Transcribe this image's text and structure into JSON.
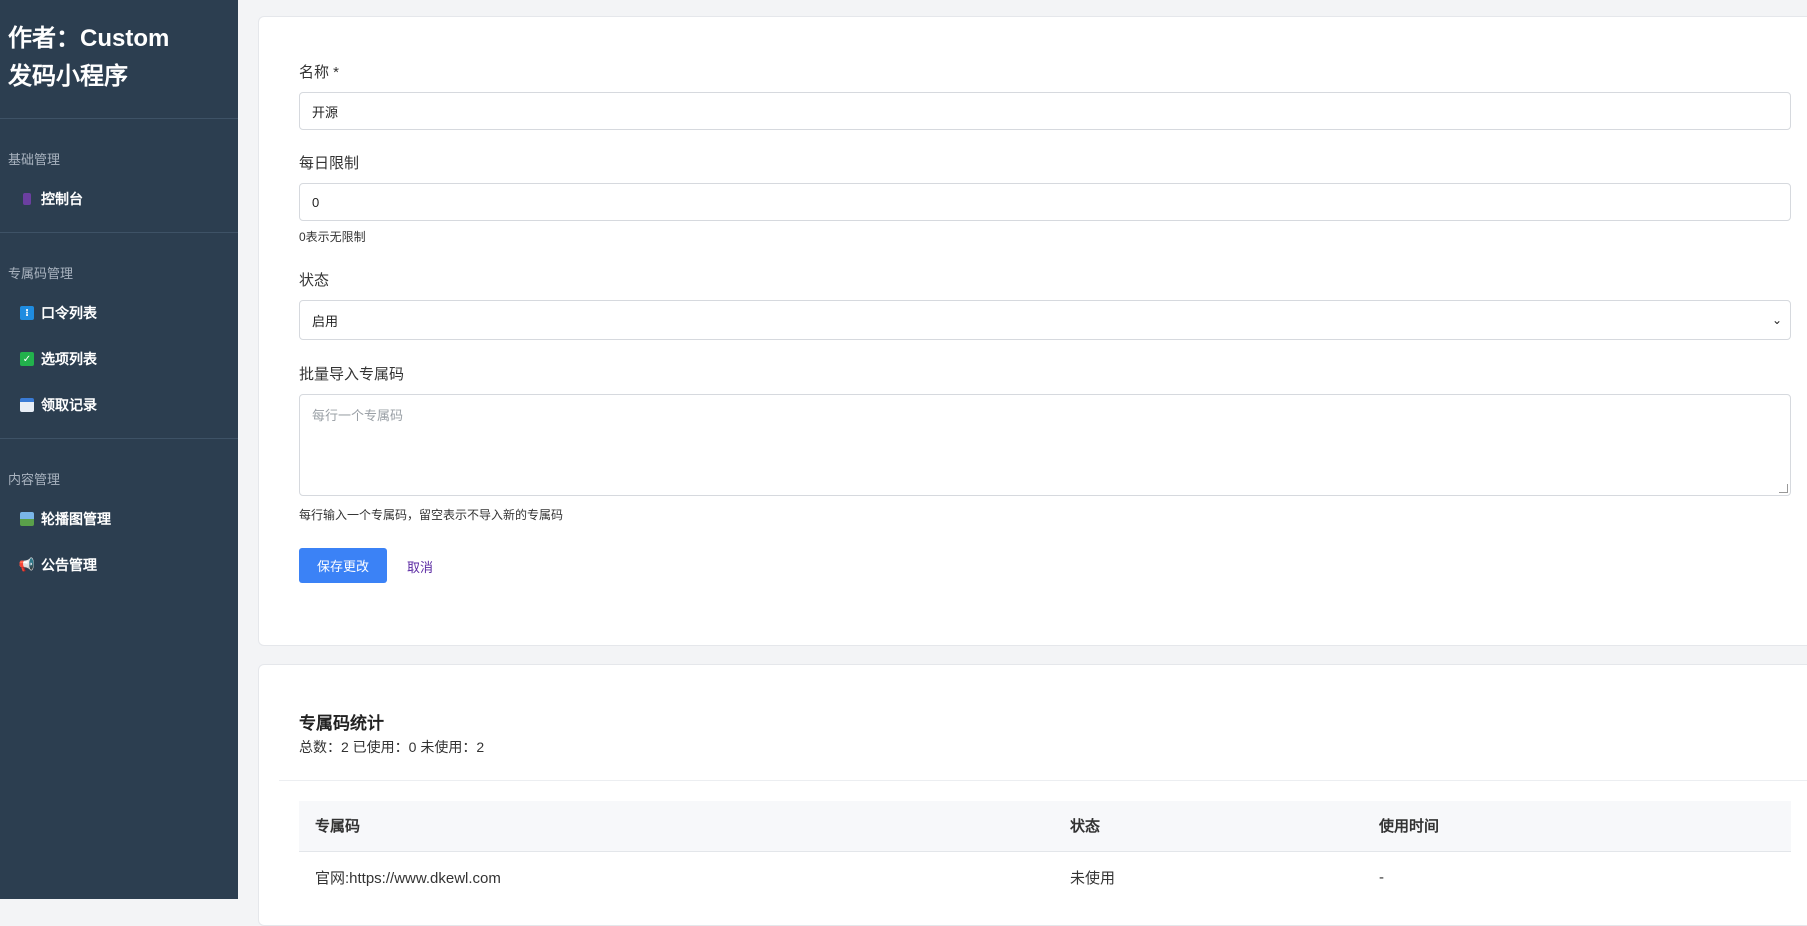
{
  "sidebar": {
    "brand_line1": "作者：Custom",
    "brand_line2": "发码小程序",
    "sections": [
      {
        "title": "基础管理",
        "items": [
          {
            "label": "控制台",
            "icon": "dashboard-icon"
          }
        ]
      },
      {
        "title": "专属码管理",
        "items": [
          {
            "label": "口令列表",
            "icon": "list-icon"
          },
          {
            "label": "选项列表",
            "icon": "check-icon"
          },
          {
            "label": "领取记录",
            "icon": "calendar-icon"
          }
        ]
      },
      {
        "title": "内容管理",
        "items": [
          {
            "label": "轮播图管理",
            "icon": "image-icon"
          },
          {
            "label": "公告管理",
            "icon": "megaphone-icon"
          }
        ]
      }
    ]
  },
  "form": {
    "name_label": "名称 *",
    "name_value": "开源",
    "limit_label": "每日限制",
    "limit_value": "0",
    "limit_help": "0表示无限制",
    "status_label": "状态",
    "status_value": "启用",
    "import_label": "批量导入专属码",
    "import_placeholder": "每行一个专属码",
    "import_help": "每行输入一个专属码，留空表示不导入新的专属码",
    "save_label": "保存更改",
    "cancel_label": "取消"
  },
  "stats": {
    "title": "专属码统计",
    "summary": "总数：2 已使用：0 未使用：2",
    "columns": [
      "专属码",
      "状态",
      "使用时间"
    ],
    "rows": [
      [
        "官网:https://www.dkewl.com",
        "未使用",
        "-"
      ]
    ]
  },
  "colors": {
    "sidebar_bg": "#2c3e50",
    "primary": "#3b82f6",
    "cancel_link": "#5b2aa3"
  }
}
